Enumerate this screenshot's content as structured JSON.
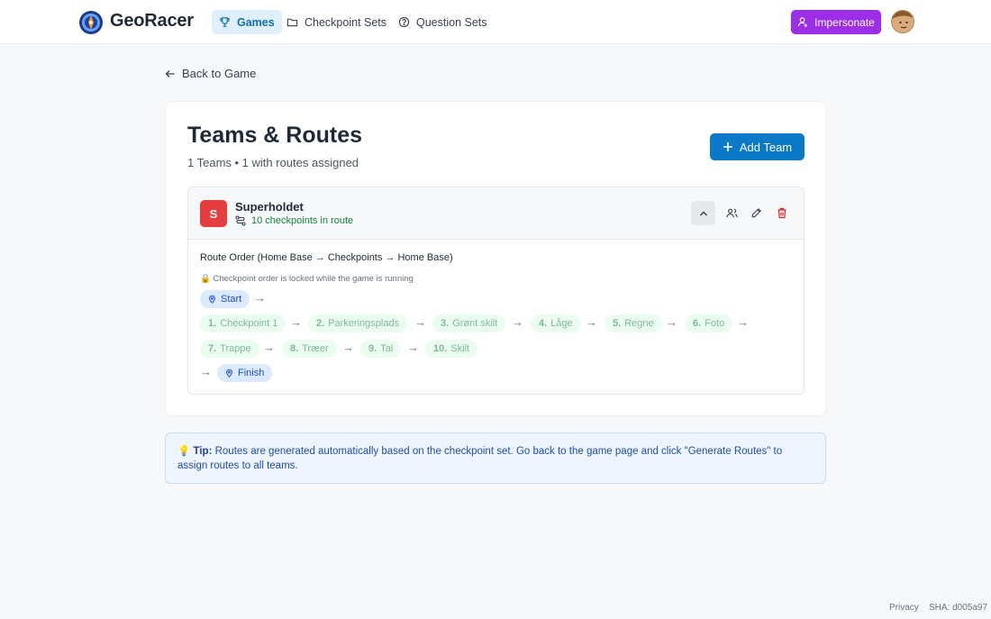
{
  "brand": "GeoRacer",
  "nav": {
    "games": "Games",
    "checkpoint_sets": "Checkpoint Sets",
    "question_sets": "Question Sets",
    "impersonate": "Impersonate"
  },
  "back_label": "Back to Game",
  "page": {
    "title": "Teams & Routes",
    "subtitle": "1 Teams • 1 with routes assigned",
    "add_team": "Add Team"
  },
  "team": {
    "initial": "S",
    "name": "Superholdet",
    "meta": "10 checkpoints in route",
    "route_title": "Route Order (Home Base → Checkpoints → Home Base)",
    "lock_note": "🔒 Checkpoint order is locked while the game is running",
    "start": "Start",
    "finish": "Finish",
    "checkpoints": [
      {
        "num": "1.",
        "name": "Checkpoint 1"
      },
      {
        "num": "2.",
        "name": "Parkeringsplads"
      },
      {
        "num": "3.",
        "name": "Grønt skilt"
      },
      {
        "num": "4.",
        "name": "Låge"
      },
      {
        "num": "5.",
        "name": "Regne"
      },
      {
        "num": "6.",
        "name": "Foto"
      },
      {
        "num": "7.",
        "name": "Trappe"
      },
      {
        "num": "8.",
        "name": "Træer"
      },
      {
        "num": "9.",
        "name": "Tal"
      },
      {
        "num": "10.",
        "name": "Skilt"
      }
    ],
    "arrow": "→"
  },
  "tip": {
    "icon": "💡",
    "label": "Tip:",
    "text": " Routes are generated automatically based on the checkpoint set. Go back to the game page and click \"Generate Routes\" to assign routes to all teams."
  },
  "footer": {
    "privacy": "Privacy",
    "sha": "SHA: d005a97"
  },
  "colors": {
    "accent": "#0b78c8",
    "impersonate": "#9b2ee6",
    "team_badge": "#e53e3e",
    "delete": "#dc2626"
  }
}
